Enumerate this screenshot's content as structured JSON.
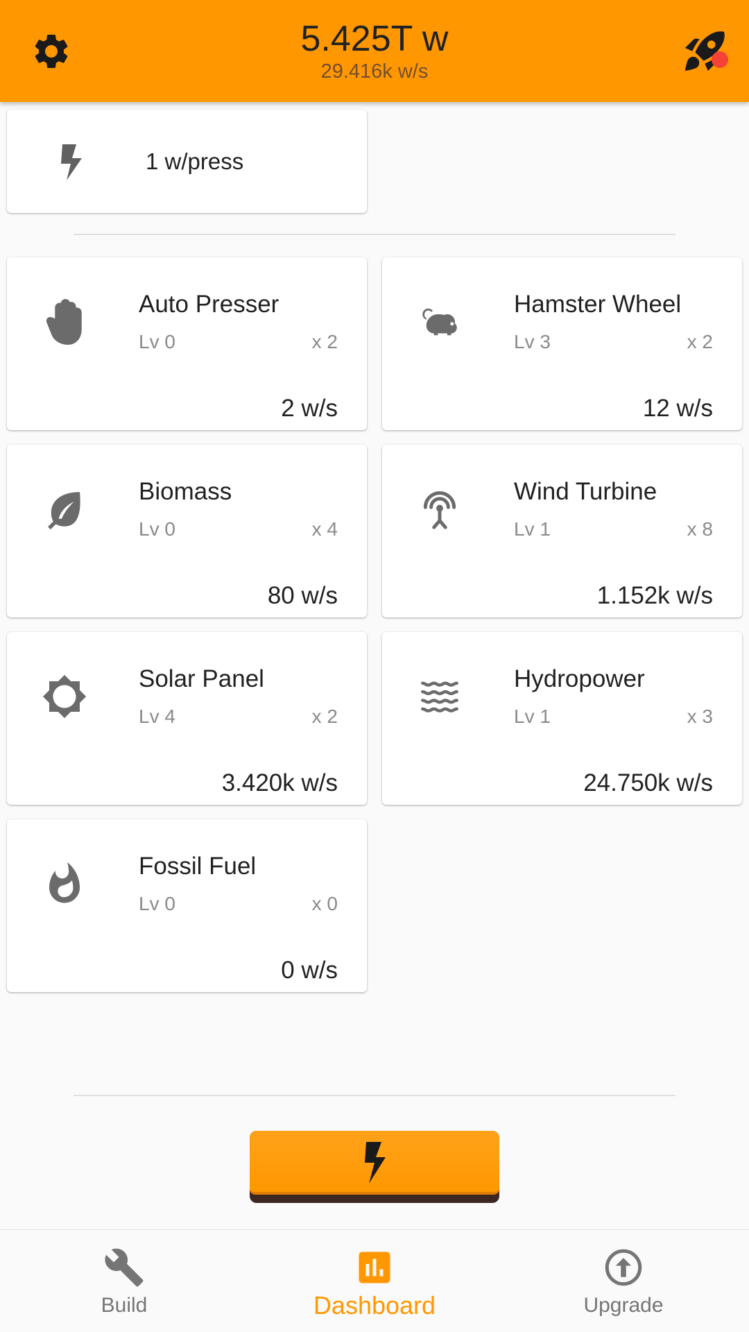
{
  "header": {
    "total": "5.425T w",
    "rate": "29.416k w/s",
    "settings_icon": "gear-icon",
    "boost_icon": "rocket-icon",
    "notification_color": "#f44336",
    "accent": "#ff9800"
  },
  "press_card": {
    "icon": "bolt-icon",
    "label": "1 w/press"
  },
  "generators": [
    {
      "name": "Auto Presser",
      "level": "Lv 0",
      "multiplier": "x 2",
      "output": "2 w/s",
      "icon": "hand-icon"
    },
    {
      "name": "Hamster Wheel",
      "level": "Lv 3",
      "multiplier": "x 2",
      "output": "12 w/s",
      "icon": "hamster-icon"
    },
    {
      "name": "Biomass",
      "level": "Lv 0",
      "multiplier": "x 4",
      "output": "80 w/s",
      "icon": "leaf-icon"
    },
    {
      "name": "Wind Turbine",
      "level": "Lv 1",
      "multiplier": "x 8",
      "output": "1.152k w/s",
      "icon": "wind-turbine-icon"
    },
    {
      "name": "Solar Panel",
      "level": "Lv 4",
      "multiplier": "x 2",
      "output": "3.420k w/s",
      "icon": "sun-icon"
    },
    {
      "name": "Hydropower",
      "level": "Lv 1",
      "multiplier": "x 3",
      "output": "24.750k w/s",
      "icon": "waves-icon"
    },
    {
      "name": "Fossil Fuel",
      "level": "Lv 0",
      "multiplier": "x 0",
      "output": "0 w/s",
      "icon": "flame-icon"
    }
  ],
  "press_button": {
    "icon": "bolt-icon"
  },
  "bottom_nav": {
    "items": [
      {
        "label": "Build",
        "icon": "wrench-icon",
        "active": false
      },
      {
        "label": "Dashboard",
        "icon": "dashboard-icon",
        "active": true
      },
      {
        "label": "Upgrade",
        "icon": "upgrade-icon",
        "active": false
      }
    ]
  }
}
